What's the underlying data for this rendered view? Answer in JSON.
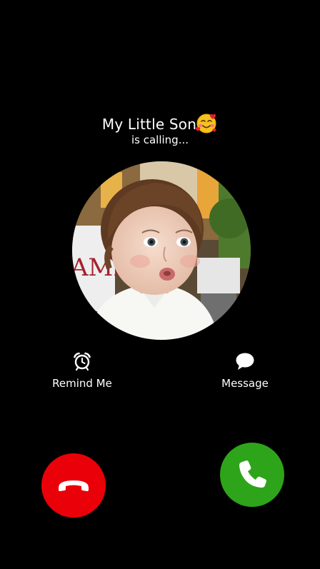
{
  "caller": {
    "name": "My Little Son",
    "name_emoji": "smiling-face-with-hearts-icon",
    "status": "is calling..."
  },
  "avatar": {
    "description_icon": "contact-photo"
  },
  "quick_actions": {
    "remind_label": "Remind Me",
    "remind_icon": "alarm-clock-icon",
    "message_label": "Message",
    "message_icon": "chat-bubble-icon"
  },
  "call_buttons": {
    "decline_icon": "phone-hangup-icon",
    "accept_icon": "phone-answer-icon"
  },
  "colors": {
    "background": "#000000",
    "text": "#ffffff",
    "decline": "#ea0008",
    "accept": "#2ea41a"
  }
}
